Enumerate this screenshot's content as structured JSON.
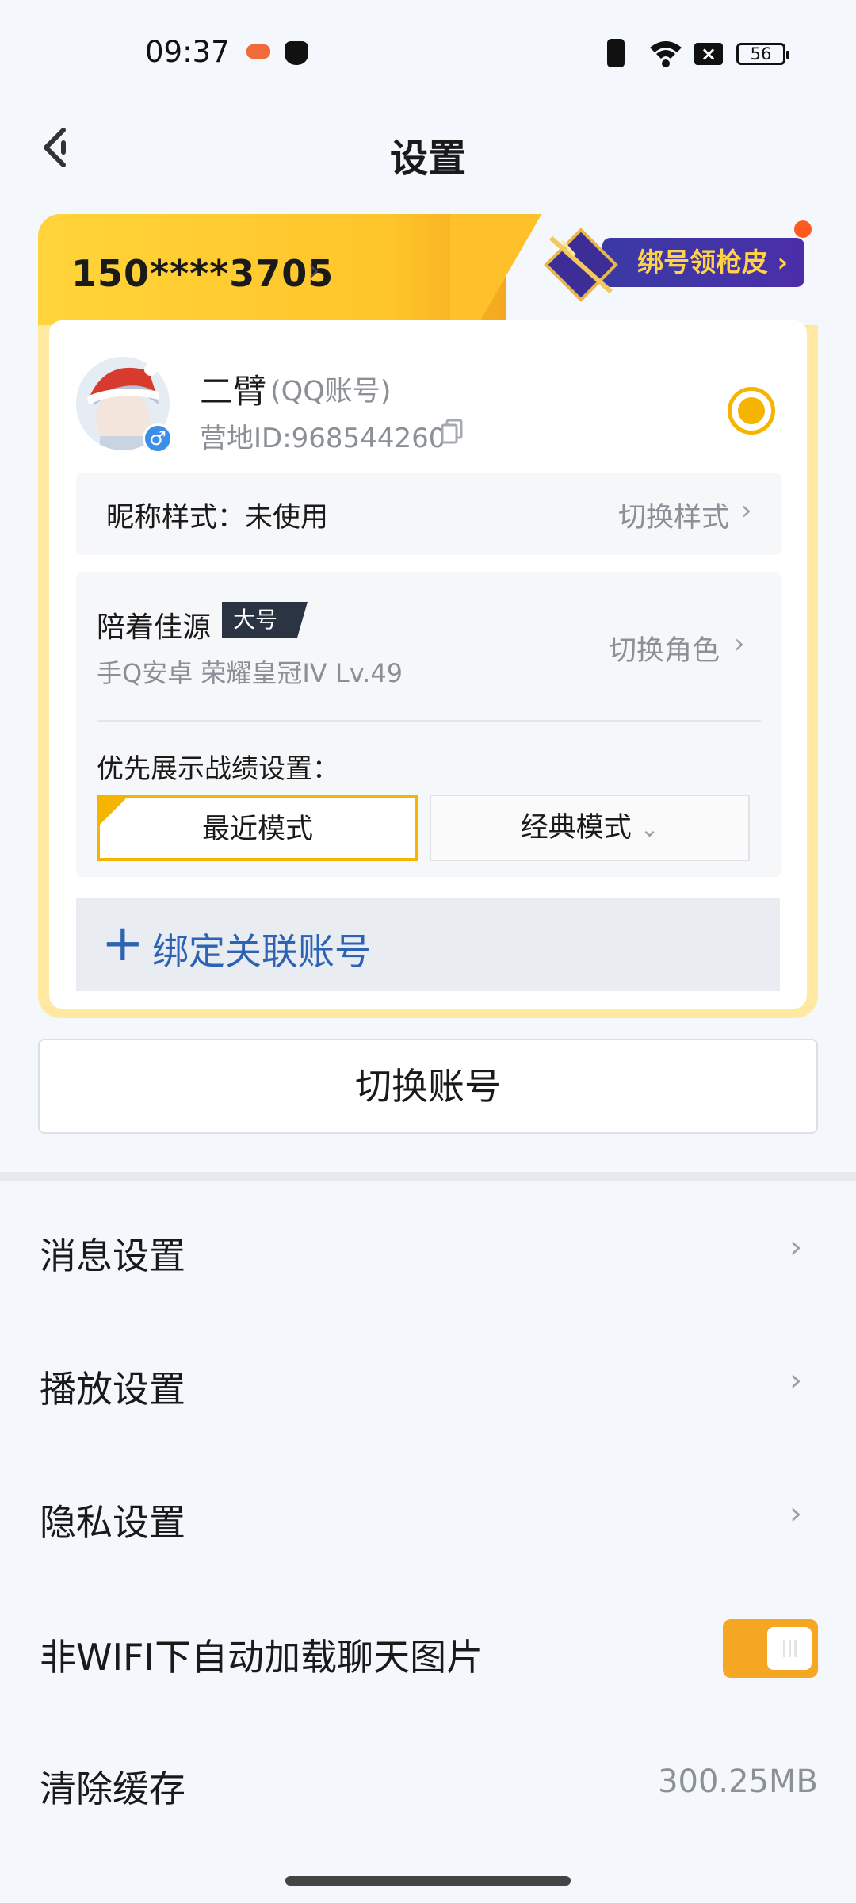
{
  "status_bar": {
    "time": "09:37",
    "battery": "56"
  },
  "header": {
    "title": "设置"
  },
  "account": {
    "phone": "150****3705",
    "promo_label": "绑号领枪皮 ›",
    "nickname": "二臂",
    "account_type": "(QQ账号)",
    "camp_id": "营地ID:968544260",
    "nick_style_label": "昵称样式：未使用",
    "nick_style_action": "切换样式",
    "role_name": "陪着佳源",
    "role_tag": "大号",
    "role_info": "手Q安卓  荣耀皇冠IV  Lv.49",
    "role_action": "切换角色",
    "priority_label": "优先展示战绩设置：",
    "mode_recent": "最近模式",
    "mode_classic": "经典模式",
    "bind_label": "绑定关联账号"
  },
  "switch_account": "切换账号",
  "menu": {
    "message": "消息设置",
    "playback": "播放设置",
    "privacy": "隐私设置",
    "auto_load": "非WIFI下自动加载聊天图片",
    "clear_cache": "清除缓存",
    "cache_size": "300.25MB"
  },
  "auto_load_enabled": true,
  "colors": {
    "accent": "#f5b400",
    "link": "#2c63b5",
    "toggle_on": "#f5a623"
  }
}
